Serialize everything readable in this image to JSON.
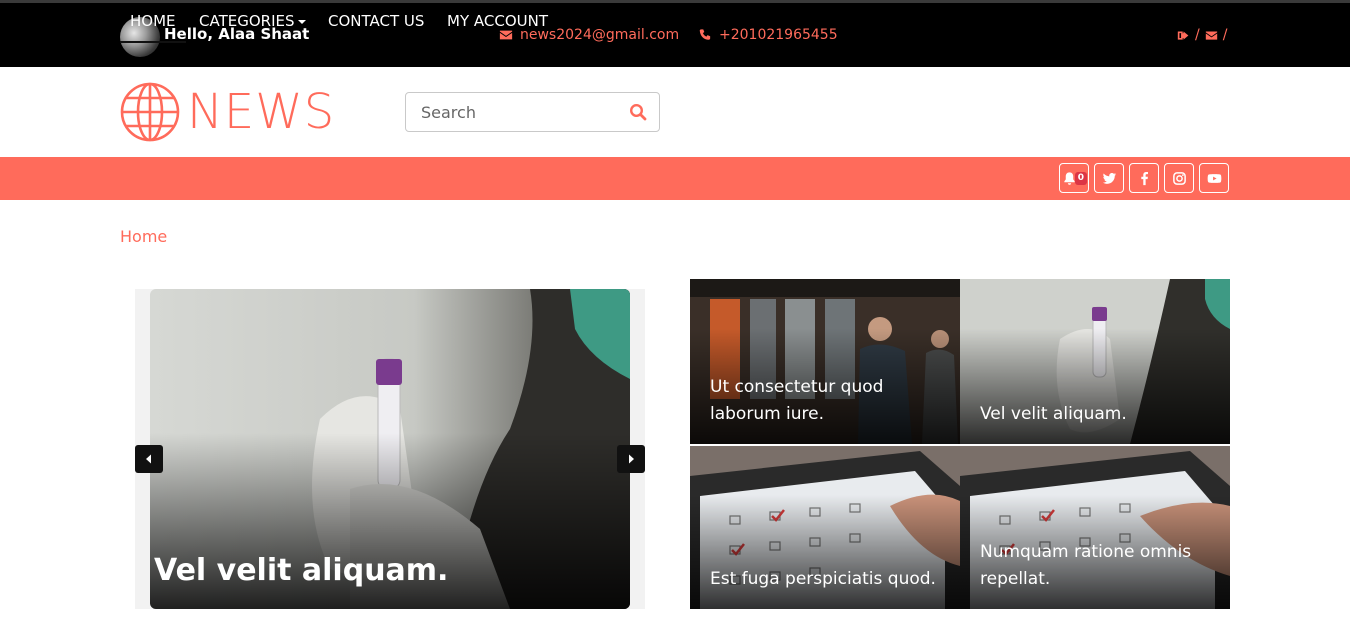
{
  "topbar": {
    "greeting": "Hello, Alaa Shaat",
    "email": "news2024@gmail.com",
    "phone": "+201021965455",
    "separator": "/"
  },
  "header": {
    "logo_text": "NEWS",
    "search_placeholder": "Search"
  },
  "nav": {
    "items": [
      {
        "label": "HOME"
      },
      {
        "label": "CATEGORIES"
      },
      {
        "label": "CONTACT US"
      },
      {
        "label": "MY ACCOUNT"
      }
    ],
    "notification_count": "0",
    "social_icons": [
      "bell-icon",
      "twitter-icon",
      "facebook-icon",
      "instagram-icon",
      "youtube-icon"
    ]
  },
  "breadcrumb": "Home",
  "slider": {
    "caption": "Vel velit aliquam."
  },
  "grid": [
    {
      "caption": "Ut consectetur quod laborum iure."
    },
    {
      "caption": "Vel velit aliquam."
    },
    {
      "caption": "Est fuga perspiciatis quod."
    },
    {
      "caption": "Numquam ratione omnis repellat."
    }
  ],
  "colors": {
    "accent": "#ff6b5b",
    "topbar_bg": "#000000",
    "badge": "#dc3545"
  }
}
